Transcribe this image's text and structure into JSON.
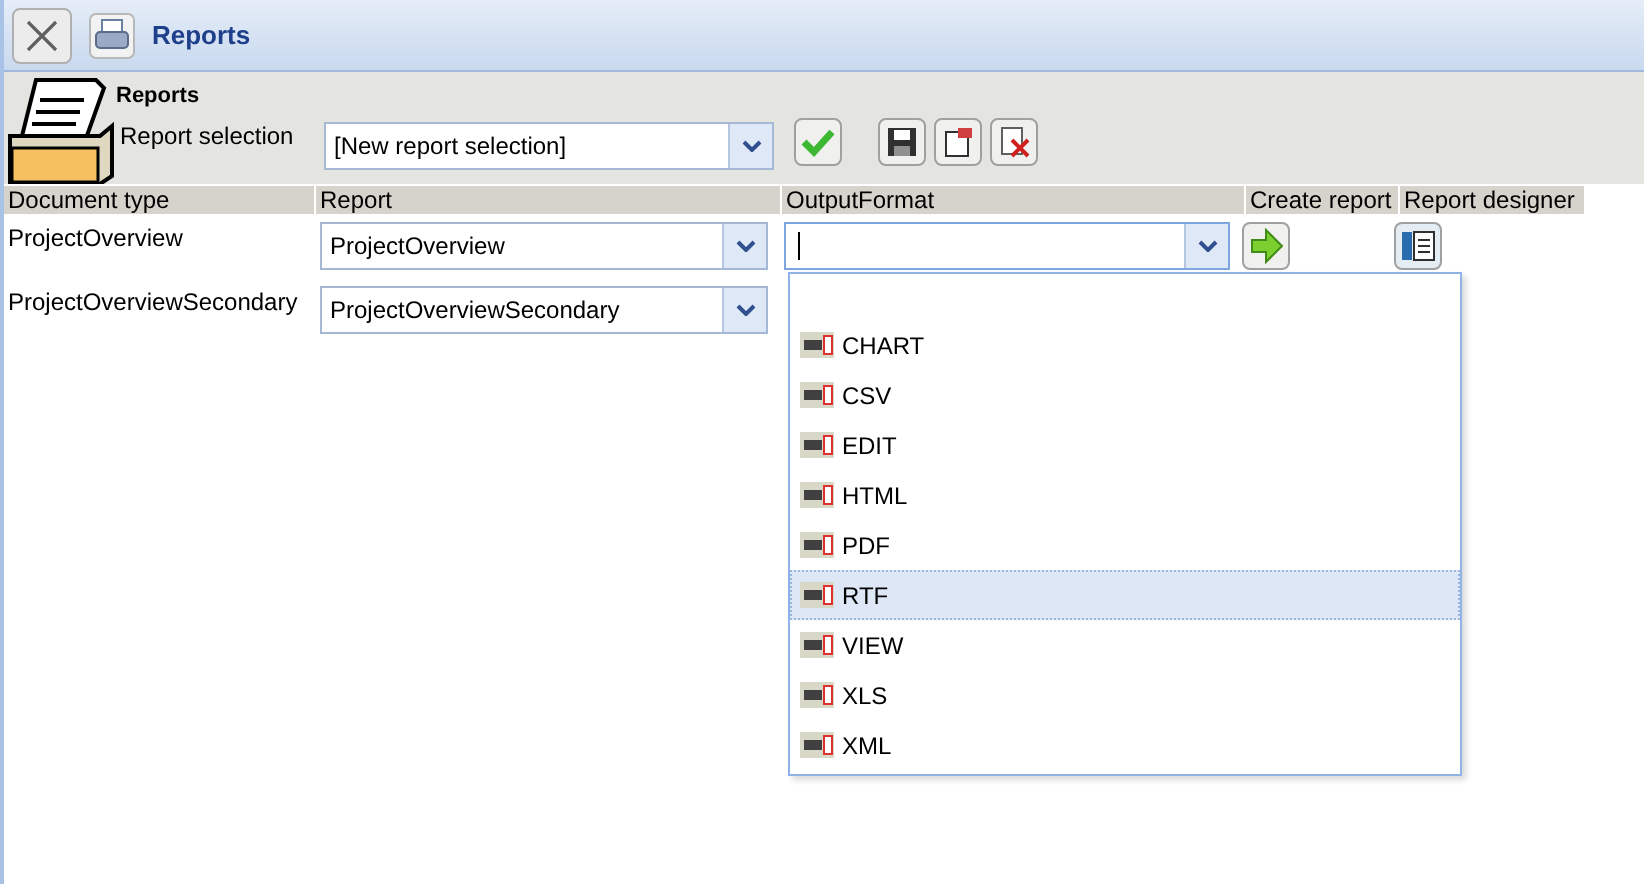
{
  "window": {
    "title": "Reports"
  },
  "header": {
    "heading": "Reports",
    "label": "Report selection",
    "selection": "[New report selection]"
  },
  "table": {
    "columns": [
      "Document type",
      "Report",
      "OutputFormat",
      "Create report",
      "Report designer"
    ],
    "rows": [
      {
        "document_type": "ProjectOverview",
        "report": "ProjectOverview"
      },
      {
        "document_type": "ProjectOverviewSecondary",
        "report": "ProjectOverviewSecondary"
      }
    ]
  },
  "format_dropdown": {
    "options": [
      {
        "label": "CHART",
        "selected": false
      },
      {
        "label": "CSV",
        "selected": false
      },
      {
        "label": "EDIT",
        "selected": false
      },
      {
        "label": "HTML",
        "selected": false
      },
      {
        "label": "PDF",
        "selected": false
      },
      {
        "label": "RTF",
        "selected": true
      },
      {
        "label": "VIEW",
        "selected": false
      },
      {
        "label": "XLS",
        "selected": false
      },
      {
        "label": "XML",
        "selected": false
      }
    ]
  }
}
